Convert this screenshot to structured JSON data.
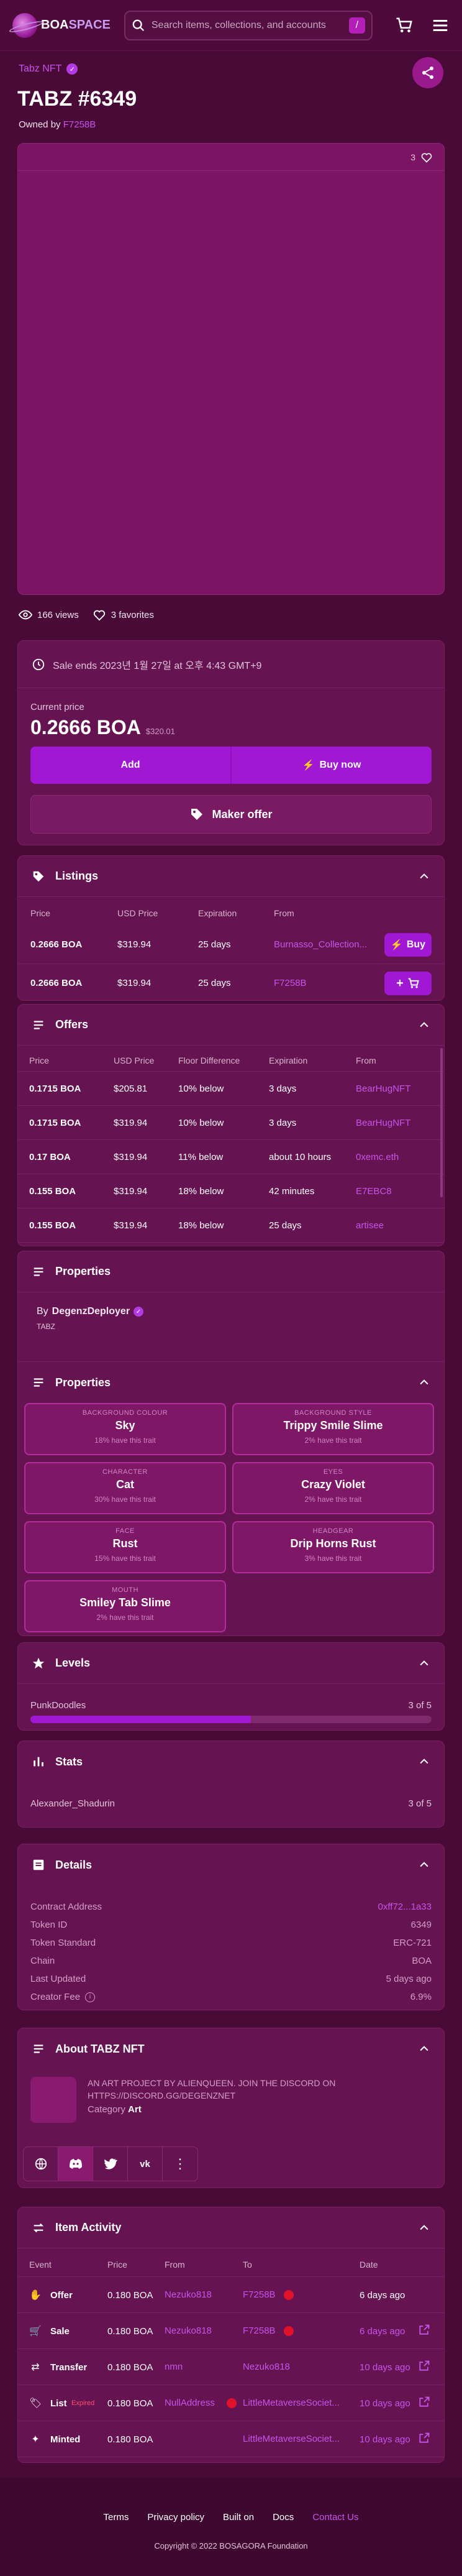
{
  "header": {
    "logo": "BOASPACE",
    "logo_left": "BOA",
    "logo_right": "SPACE",
    "search_placeholder": "Search items, collections, and accounts",
    "slash": "/"
  },
  "collection": "Tabz NFT",
  "title": "TABZ #6349",
  "owned_prefix": "Owned by",
  "owner": "F7258B",
  "favorites_count": "3",
  "views": "166 views",
  "favorites": "3 favorites",
  "sale": {
    "ends": "Sale ends 2023년 1월 27일 at 오후 4:43 GMT+9",
    "current_label": "Current price",
    "price": "0.2666 BOA",
    "usd": "$320.01",
    "add": "Add",
    "buy": "Buy now",
    "offer": "Maker offer"
  },
  "listings": {
    "title": "Listings",
    "headers": [
      "Price",
      "USD Price",
      "Expiration",
      "From"
    ],
    "rows": [
      {
        "price": "0.2666 BOA",
        "usd": "$319.94",
        "exp": "25 days",
        "from": "Burnasso_Collection...",
        "action": "Buy"
      },
      {
        "price": "0.2666 BOA",
        "usd": "$319.94",
        "exp": "25 days",
        "from": "F7258B",
        "action": ""
      }
    ]
  },
  "offers": {
    "title": "Offers",
    "headers": [
      "Price",
      "USD Price",
      "Floor Difference",
      "Expiration",
      "From"
    ],
    "rows": [
      {
        "price": "0.1715 BOA",
        "usd": "$205.81",
        "diff": "10% below",
        "exp": "3 days",
        "from": "BearHugNFT"
      },
      {
        "price": "0.1715 BOA",
        "usd": "$319.94",
        "diff": "10% below",
        "exp": "3 days",
        "from": "BearHugNFT"
      },
      {
        "price": "0.17 BOA",
        "usd": "$319.94",
        "diff": "11% below",
        "exp": "about 10 hours",
        "from": "0xemc.eth"
      },
      {
        "price": "0.155 BOA",
        "usd": "$319.94",
        "diff": "18% below",
        "exp": "42 minutes",
        "from": "E7EBC8"
      },
      {
        "price": "0.155 BOA",
        "usd": "$319.94",
        "diff": "18% below",
        "exp": "25 days",
        "from": "artisee"
      }
    ]
  },
  "properties": {
    "title": "Properties",
    "by_prefix": "By",
    "creator": "DegenzDeployer",
    "sub": "TABZ",
    "inner_title": "Properties",
    "traits": [
      {
        "type": "BACKGROUND COLOUR",
        "value": "Sky",
        "pct": "18% have this trait"
      },
      {
        "type": "BACKGROUND STYLE",
        "value": "Trippy Smile Slime",
        "pct": "2% have this trait"
      },
      {
        "type": "CHARACTER",
        "value": "Cat",
        "pct": "30% have this trait"
      },
      {
        "type": "EYES",
        "value": "Crazy Violet",
        "pct": "2% have this trait"
      },
      {
        "type": "FACE",
        "value": "Rust",
        "pct": "15% have this trait"
      },
      {
        "type": "HEADGEAR",
        "value": "Drip Horns Rust",
        "pct": "3% have this trait"
      },
      {
        "type": "MOUTH",
        "value": "Smiley Tab Slime",
        "pct": "2% have this trait"
      }
    ]
  },
  "levels": {
    "title": "Levels",
    "name": "PunkDoodles",
    "value": "3 of 5",
    "fraction": 0.55
  },
  "stats": {
    "title": "Stats",
    "name": "Alexander_Shadurin",
    "value": "3 of 5"
  },
  "details": {
    "title": "Details",
    "rows": [
      {
        "k": "Contract Address",
        "v": "0xff72...1a33"
      },
      {
        "k": "Token ID",
        "v": "6349"
      },
      {
        "k": "Token Standard",
        "v": "ERC-721"
      },
      {
        "k": "Chain",
        "v": "BOA"
      },
      {
        "k": "Last Updated",
        "v": "5 days ago"
      },
      {
        "k": "Creator Fee",
        "v": "6.9%"
      }
    ]
  },
  "about": {
    "title": "About TABZ NFT",
    "text": "AN ART PROJECT BY ALIENQUEEN. JOIN THE DISCORD ON HTTPS://DISCORD.GG/DEGENZNET",
    "category_label": "Category",
    "category": "Art"
  },
  "activity": {
    "title": "Item Activity",
    "headers": [
      "Event",
      "Price",
      "From",
      "To",
      "Date"
    ],
    "rows": [
      {
        "event": "Offer",
        "price": "0.180 BOA",
        "from": "Nezuko818",
        "to": "F7258B",
        "date": "6 days ago",
        "expired": "",
        "link": false,
        "to_dot": true,
        "from_dot": false
      },
      {
        "event": "Sale",
        "price": "0.180 BOA",
        "from": "Nezuko818",
        "to": "F7258B",
        "date": "6 days ago",
        "expired": "",
        "link": true,
        "to_dot": true,
        "from_dot": false
      },
      {
        "event": "Transfer",
        "price": "0.180 BOA",
        "from": "nmn",
        "to": "Nezuko818",
        "date": "10 days ago",
        "expired": "",
        "link": true,
        "to_dot": false,
        "from_dot": false
      },
      {
        "event": "List",
        "price": "0.180 BOA",
        "from": "NullAddress",
        "to": "LittleMetaverseSociet...",
        "date": "10 days ago",
        "expired": "Expired",
        "link": true,
        "to_dot": false,
        "from_dot": true
      },
      {
        "event": "Minted",
        "price": "0.180 BOA",
        "from": "",
        "to": "LittleMetaverseSociet...",
        "date": "10 days ago",
        "expired": "",
        "link": true,
        "to_dot": false,
        "from_dot": false
      }
    ]
  },
  "footer": {
    "links": [
      "Terms",
      "Privacy policy",
      "Built on",
      "Docs",
      "Contact Us"
    ],
    "copyright": "Copyright © 2022 BOSAGORA Foundation"
  },
  "colors": {
    "bg": "#4a0a38",
    "card": "#651451",
    "accent": "#a018d4",
    "link": "#c653ea"
  }
}
